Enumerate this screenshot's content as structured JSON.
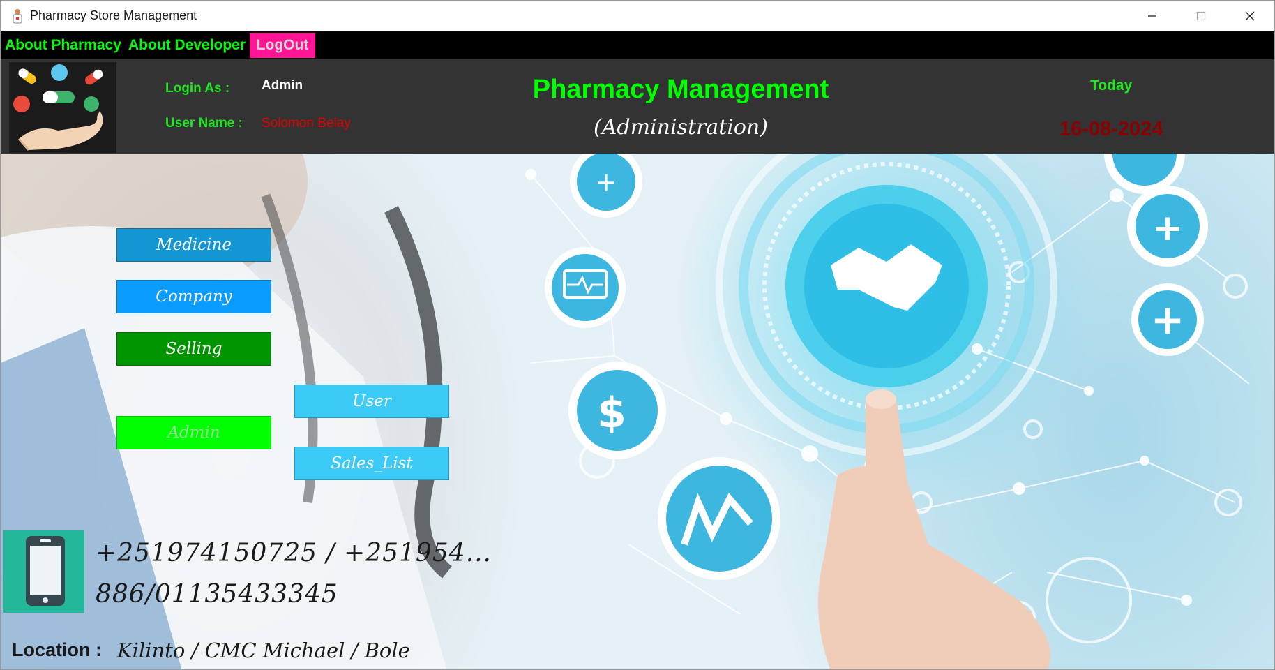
{
  "window": {
    "title": "Pharmacy Store Management"
  },
  "menu": {
    "about_pharmacy": "About Pharmacy",
    "about_developer": "About Developer",
    "logout": "LogOut"
  },
  "header": {
    "login_as_label": "Login As :",
    "login_as_value": "Admin",
    "user_name_label": "User Name :",
    "user_name_value": "Solomon Belay",
    "title": "Pharmacy Management",
    "subtitle": "(Administration)",
    "today_label": "Today",
    "today_value": "16-08-2024"
  },
  "nav": {
    "medicine": "Medicine",
    "company": "Company",
    "selling": "Selling",
    "admin": "Admin",
    "user": "User",
    "sales_list": "Sales_List"
  },
  "footer": {
    "phone_line1": "+251974150725 / +251954...",
    "phone_line2": "886/01135433345",
    "location_label": "Location :",
    "location_value": "Kilinto / CMC Michael / Bole"
  },
  "colors": {
    "menu_text": "#00ff00",
    "logout_bg": "#ff1493",
    "header_bg": "#333333",
    "user_name_color": "#e00000",
    "date_color": "#8b0000",
    "medicine_bg": "#1496d2",
    "company_bg": "#0a9cff",
    "selling_bg": "#009400",
    "admin_bg": "#00ff00",
    "user_bg": "#3ccaf7"
  },
  "icons": [
    "pharmacist-icon",
    "pills-hand-logo",
    "phone-icon",
    "minimize-icon",
    "maximize-icon",
    "close-icon"
  ]
}
